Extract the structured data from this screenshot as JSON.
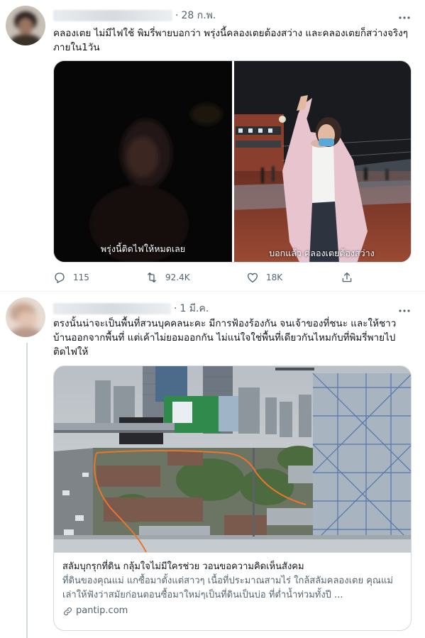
{
  "tweets": [
    {
      "date": "28 ก.พ.",
      "text": "คลองเตย ไม่มีไฟใช้ พิมรี่พายบอกว่า พรุ่งนี้คลองเตยต้องสว่าง และคลองเตยก็สว่างจริงๆ ภายใน1วัน",
      "media_left_caption": "พรุ่งนี้ติดไฟให้หมดเลย",
      "media_right_caption": "บอกแล้ว คลองเตยต้องสว่าง",
      "replies": "115",
      "retweets": "92.4K",
      "likes": "18K"
    },
    {
      "date": "1 มี.ค.",
      "text": "ตรงนั้นน่าจะเป็นพื้นที่สวนบุคคลนะคะ มีการฟ้องร้องกัน จนเจ้าของที่ชนะ และให้ชาวบ้านออกจากพื้นที่ แต่เค้าไม่ยอมออกกัน ไม่แน่ใจใช่พื้นที่เดียวกันไหมกับที่พิมรี่พายไปติดไฟให้",
      "card": {
        "title": "สลัมบุกรุกที่ดิน กลุ้มใจไม่มีใครช่วย วอนขอความคิดเห็นสังคม",
        "description": "ที่ดินของคุณแม่ แกซื้อมาตั้งแต่สาวๆ เนื้อที่ประมาณสามไร่ ใกล้สลัมคลองเตย คุณแม่เล่าให้ฟังว่าสมัยก่อนตอนซื้อมาใหม่ๆเป็นที่ดินเป็นบ่อ ที่ต่ำน้ำท่วมทั้งปี ...",
        "domain": "pantip.com"
      }
    }
  ],
  "icons": {
    "reply": "reply-icon",
    "retweet": "retweet-icon",
    "like": "heart-icon",
    "share": "share-icon",
    "more": "more-icon",
    "link": "link-icon"
  },
  "colors": {
    "text": "#0f1419",
    "secondary": "#536471",
    "border": "#cfd9de",
    "route_line": "#e8762d"
  }
}
